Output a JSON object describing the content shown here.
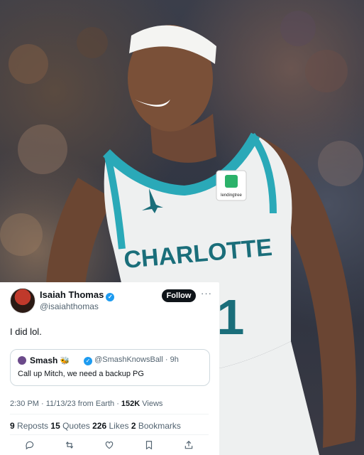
{
  "tweet": {
    "author_name": "Isaiah Thomas",
    "author_handle": "@isaiahthomas",
    "follow_label": "Follow",
    "more_label": "···",
    "text": "I did lol.",
    "quoted": {
      "author_name": "Smash",
      "emoji": "🐝",
      "author_handle": "@SmashKnowsBall · 9h",
      "text": "Call up Mitch, we need a backup PG"
    },
    "meta": {
      "time_source": "2:30 PM · 11/13/23 from Earth · ",
      "views_count": "152K",
      "views_label": " Views"
    },
    "stats": {
      "reposts_count": "9",
      "reposts_label": " Reposts  ",
      "quotes_count": "15",
      "quotes_label": " Quotes  ",
      "likes_count": "226",
      "likes_label": " Likes  ",
      "bookmarks_count": "2",
      "bookmarks_label": " Bookmarks"
    },
    "actions": [
      "reply-icon",
      "repost-icon",
      "like-icon",
      "bookmark-icon",
      "share-icon"
    ]
  },
  "photo": {
    "jersey_text": "CHARLOTTE",
    "jersey_number": "1",
    "sponsor": "lendingtree"
  }
}
